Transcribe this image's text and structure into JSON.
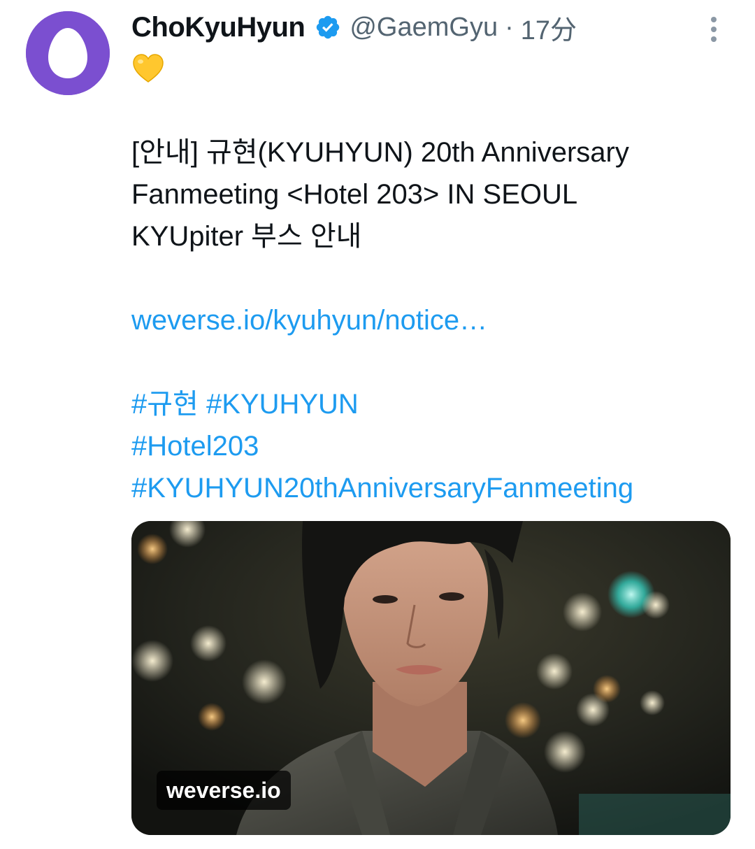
{
  "tweet": {
    "author": {
      "display_name": "ChoKyuHyun",
      "handle": "@GaemGyu",
      "verified": true,
      "avatar_icon": "egg-avatar-icon",
      "avatar_color": "#7b4fd0"
    },
    "separator": "·",
    "time": "17分",
    "more_icon": "more-vertical-icon",
    "emoji": "yellow-heart-icon",
    "text_lines": [
      "[안내] 규현(KYUHYUN) 20th Anniversary",
      "Fanmeeting <Hotel 203> IN SEOUL",
      "KYUpiter 부스 안내"
    ],
    "link": "weverse.io/kyuhyun/notice…",
    "hashtag_lines": [
      "#규현 #KYUHYUN",
      "#Hotel203",
      "#KYUHYUN20thAnniversaryFanmeeting"
    ],
    "card": {
      "domain": "weverse.io"
    }
  },
  "colors": {
    "text": "#0f1419",
    "secondary": "#536471",
    "link": "#1d9bf0",
    "verified": "#1d9bf0"
  }
}
